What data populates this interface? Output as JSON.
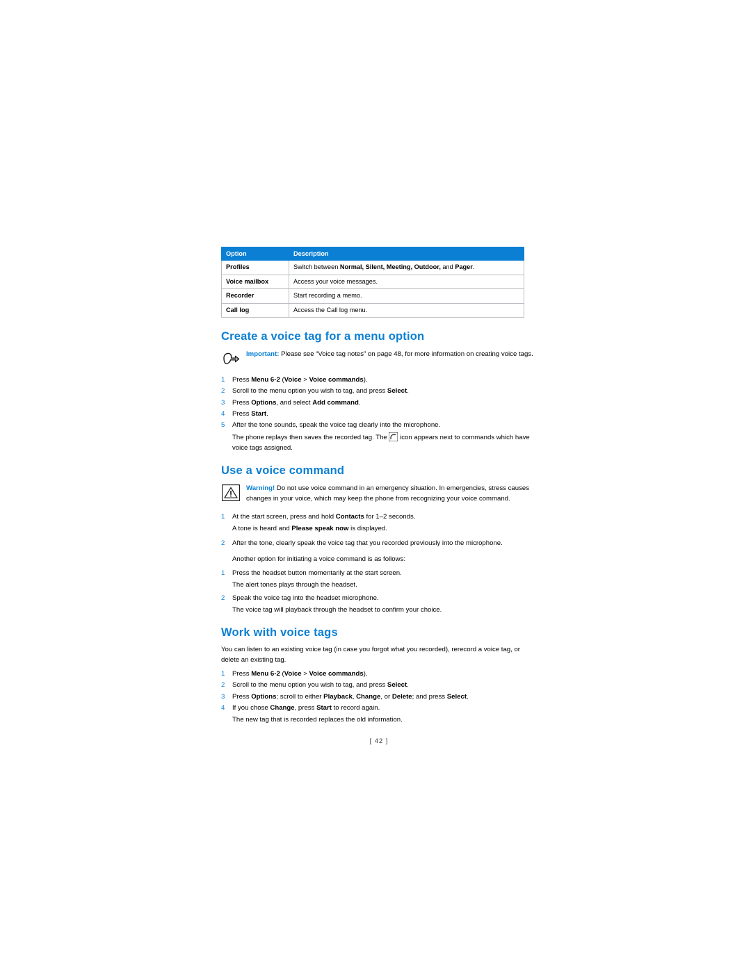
{
  "table": {
    "headers": [
      "Option",
      "Description"
    ],
    "rows": [
      {
        "option": "Profiles",
        "description_pre": "Switch between ",
        "description_bold": "Normal, Silent, Meeting, Outdoor,",
        "description_mid": " and ",
        "description_bold2": "Pager",
        "description_post": "."
      },
      {
        "option": "Voice mailbox",
        "description": "Access your voice messages."
      },
      {
        "option": "Recorder",
        "description": "Start recording a memo."
      },
      {
        "option": "Call log",
        "description": "Access the Call log menu."
      }
    ]
  },
  "section1": {
    "heading": "Create a voice tag for a menu option",
    "note": {
      "label": "Important:",
      "text": " Please see “Voice tag notes” on page 48, for more information on creating voice tags."
    },
    "steps": [
      {
        "num": "1",
        "pre": "Press ",
        "b1": "Menu 6-2",
        "mid": " (",
        "b2": "Voice",
        "mid2": " > ",
        "b3": "Voice commands",
        "post": ")."
      },
      {
        "num": "2",
        "pre": "Scroll to the menu option you wish to tag, and press ",
        "b1": "Select",
        "post": "."
      },
      {
        "num": "3",
        "pre": "Press ",
        "b1": "Options",
        "mid": ", and select ",
        "b2": "Add command",
        "post": "."
      },
      {
        "num": "4",
        "pre": "Press ",
        "b1": "Start",
        "post": "."
      },
      {
        "num": "5",
        "pre": "After the tone sounds, speak the voice tag clearly into the microphone.",
        "post": ""
      }
    ],
    "continuation_pre": "The phone replays then saves the recorded tag. The ",
    "continuation_post": " icon appears next to commands which have voice tags assigned."
  },
  "section2": {
    "heading": "Use a voice command",
    "warning": {
      "label": "Warning!",
      "text": " Do not use voice command in an emergency situation. In emergencies, stress causes changes in your voice, which may keep the phone from recognizing your voice command."
    },
    "steps": [
      {
        "num": "1",
        "pre": "At the start screen, press and hold ",
        "b1": "Contacts",
        "post": " for 1–2 seconds."
      },
      {
        "num": "2",
        "pre": "After the tone, clearly speak the voice tag that you recorded previously into the microphone.",
        "post": ""
      }
    ],
    "after_step1_pre": "A tone is heard and ",
    "after_step1_bold": "Please speak now",
    "after_step1_post": " is displayed.",
    "another_option": "Another option for initiating a voice command is as follows:",
    "steps2": [
      {
        "num": "1",
        "pre": "Press the headset button momentarily at the start screen.",
        "post": ""
      },
      {
        "num": "2",
        "pre": "Speak the voice tag into the headset microphone.",
        "post": ""
      }
    ],
    "after_a1": "The alert tones plays through the headset.",
    "after_a2": "The voice tag will playback through the headset to confirm your choice."
  },
  "section3": {
    "heading": "Work with voice tags",
    "intro": "You can listen to an existing voice tag (in case you forgot what you recorded), rerecord a voice tag, or delete an existing tag.",
    "steps": [
      {
        "num": "1",
        "pre": "Press ",
        "b1": "Menu 6-2",
        "mid": " (",
        "b2": "Voice",
        "mid2": " > ",
        "b3": "Voice commands",
        "post": ")."
      },
      {
        "num": "2",
        "pre": "Scroll to the menu option you wish to tag, and press ",
        "b1": "Select",
        "post": "."
      },
      {
        "num": "3",
        "pre": "Press ",
        "b1": "Options",
        "mid": "; scroll to either ",
        "b2": "Playback",
        "mid2": ", ",
        "b3": "Change",
        "mid3": ", or ",
        "b4": "Delete",
        "mid4": "; and press ",
        "b5": "Select",
        "post": "."
      },
      {
        "num": "4",
        "pre": "If you chose ",
        "b1": "Change",
        "mid": ", press ",
        "b2": "Start",
        "post": " to record again."
      }
    ],
    "closing": "The new tag that is recorded replaces the old information."
  },
  "footer": {
    "page_number": "[ 42 ]"
  },
  "colors": {
    "accent": "#0a7fd4",
    "table_border": "#b9bdc1"
  }
}
